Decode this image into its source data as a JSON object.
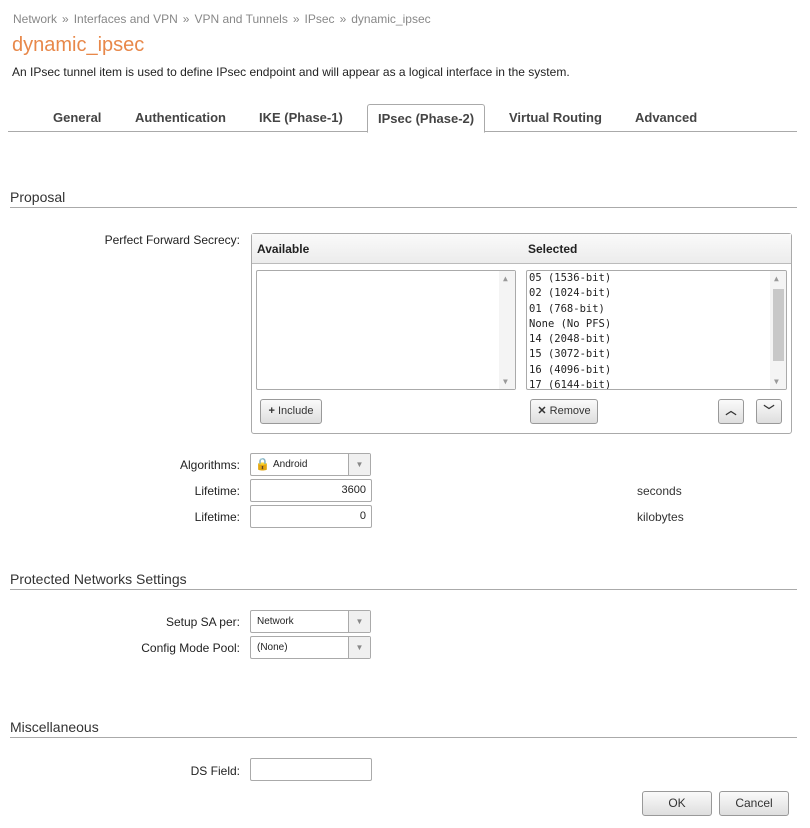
{
  "breadcrumb": [
    "Network",
    "Interfaces and VPN",
    "VPN and Tunnels",
    "IPsec",
    "dynamic_ipsec"
  ],
  "breadcrumb_sep": "»",
  "title": "dynamic_ipsec",
  "description": "An IPsec tunnel item is used to define IPsec endpoint and will appear as a logical interface in the system.",
  "tabs": [
    "General",
    "Authentication",
    "IKE (Phase-1)",
    "IPsec (Phase-2)",
    "Virtual Routing",
    "Advanced"
  ],
  "active_tab": "IPsec (Phase-2)",
  "proposal": {
    "heading": "Proposal",
    "pfs_label": "Perfect Forward Secrecy:",
    "available_header": "Available",
    "selected_header": "Selected",
    "available_items": [],
    "selected_items": [
      "05 (1536-bit)",
      "02 (1024-bit)",
      "01 (768-bit)",
      "None (No PFS)",
      "14 (2048-bit)",
      "15 (3072-bit)",
      "16 (4096-bit)",
      "17 (6144-bit)"
    ],
    "include_label": "Include",
    "remove_label": "Remove",
    "algorithms_label": "Algorithms:",
    "algorithms_value": "Android",
    "lifetime_label": "Lifetime:",
    "lifetime_seconds": "3600",
    "seconds_unit": "seconds",
    "lifetime_kb": "0",
    "kb_unit": "kilobytes"
  },
  "protected": {
    "heading": "Protected Networks Settings",
    "setup_sa_label": "Setup SA per:",
    "setup_sa_value": "Network",
    "config_pool_label": "Config Mode Pool:",
    "config_pool_value": "(None)"
  },
  "misc": {
    "heading": "Miscellaneous",
    "ds_label": "DS Field:",
    "ds_value": ""
  },
  "ok_label": "OK",
  "cancel_label": "Cancel"
}
